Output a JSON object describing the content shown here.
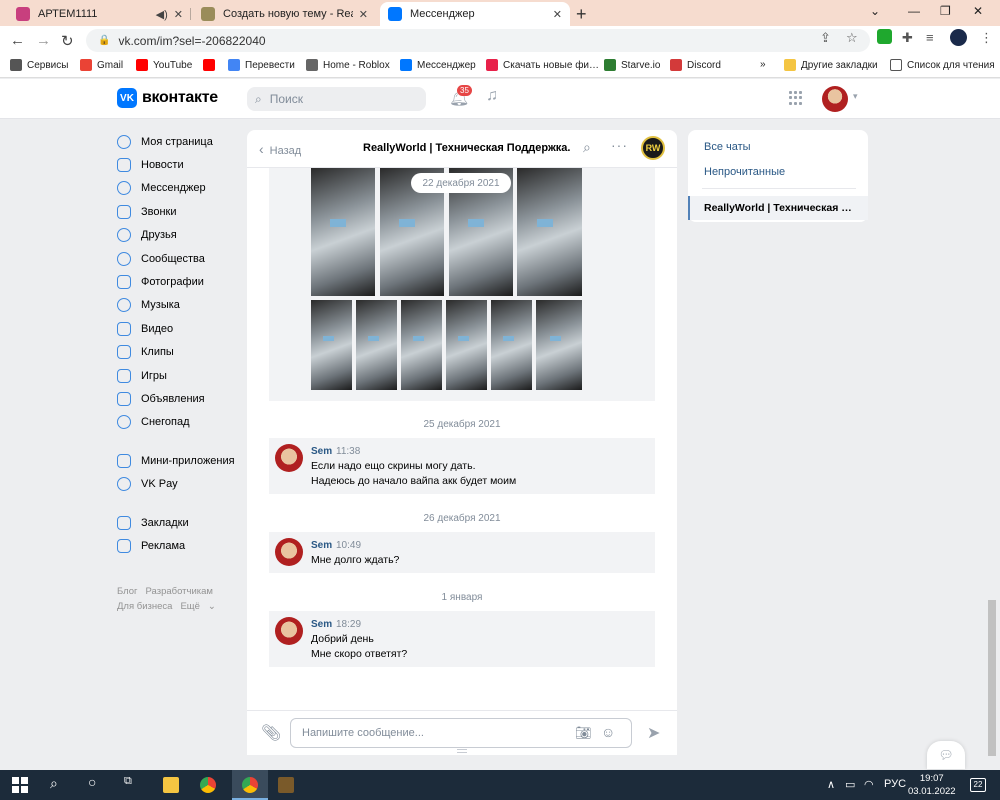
{
  "browser": {
    "tabs": [
      {
        "title": "АРТЕМ1111",
        "fav_color": "#c83f7e"
      },
      {
        "title": "Создать новую тему - ReallyWo…",
        "fav_color": "#9a8c5a"
      },
      {
        "title": "Мессенджер",
        "fav_color": "#0077ff",
        "active": true
      }
    ],
    "url": "vk.com/im?sel=-206822040",
    "bookmarks": [
      {
        "label": "Сервисы",
        "color": "#555555"
      },
      {
        "label": "Gmail",
        "color": "#ea4335"
      },
      {
        "label": "YouTube",
        "color": "#ff0000"
      },
      {
        "label": "",
        "color": "#ff0000"
      },
      {
        "label": "Перевести",
        "color": "#4285f4"
      },
      {
        "label": "Home - Roblox",
        "color": "#666666"
      },
      {
        "label": "Мессенджер",
        "color": "#0077ff"
      },
      {
        "label": "Скачать новые фи…",
        "color": "#e8214a"
      },
      {
        "label": "Starve.io",
        "color": "#2e7d32"
      },
      {
        "label": "Discord",
        "color": "#d33a3a"
      }
    ],
    "bookmarks_more": "»",
    "other_bookmarks": "Другие закладки",
    "reading_list": "Список для чтения"
  },
  "vk": {
    "logo_text": "вконтакте",
    "search_placeholder": "Поиск",
    "notifications_count": "35",
    "menu": [
      {
        "label": "Моя страница",
        "icon": "user-circle-icon"
      },
      {
        "label": "Новости",
        "icon": "news-icon"
      },
      {
        "label": "Мессенджер",
        "icon": "message-icon"
      },
      {
        "label": "Звонки",
        "icon": "phone-icon"
      },
      {
        "label": "Друзья",
        "icon": "friends-icon"
      },
      {
        "label": "Сообщества",
        "icon": "communities-icon"
      },
      {
        "label": "Фотографии",
        "icon": "photo-icon"
      },
      {
        "label": "Музыка",
        "icon": "music-icon"
      },
      {
        "label": "Видео",
        "icon": "video-icon"
      },
      {
        "label": "Клипы",
        "icon": "clips-icon"
      },
      {
        "label": "Игры",
        "icon": "games-icon"
      },
      {
        "label": "Объявления",
        "icon": "classifieds-icon"
      },
      {
        "label": "Снегопад",
        "icon": "snowflake-icon"
      }
    ],
    "menu2": [
      {
        "label": "Мини-приложения",
        "icon": "apps-icon"
      },
      {
        "label": "VK Pay",
        "icon": "vkpay-icon"
      }
    ],
    "menu3": [
      {
        "label": "Закладки",
        "icon": "star-icon"
      },
      {
        "label": "Реклама",
        "icon": "ads-icon"
      }
    ],
    "footer": {
      "blog": "Блог",
      "devs": "Разработчикам",
      "business": "Для бизнеса",
      "more": "Ещё"
    }
  },
  "chat": {
    "back_label": "Назад",
    "title": "ReallyWorld | Техническая Поддержка.",
    "avatar_text": "RW",
    "photo_date": "22 декабря 2021",
    "groups": [
      {
        "date": "25 декабря 2021",
        "author": "Sem",
        "time": "11:38",
        "lines": [
          "Если надо ещо скрины могу дать.",
          "Надеюсь до начало вайпа акк будет моим"
        ]
      },
      {
        "date": "26 декабря 2021",
        "author": "Sem",
        "time": "10:49",
        "lines": [
          "Мне долго ждать?"
        ]
      },
      {
        "date": "1 января",
        "author": "Sem",
        "time": "18:29",
        "lines": [
          "Добрий день",
          "Мне скоро ответят?"
        ]
      }
    ],
    "composer_placeholder": "Напишите сообщение..."
  },
  "right": {
    "all_chats": "Все чаты",
    "unread": "Непрочитанные",
    "active_chat": "ReallyWorld | Техническая …"
  },
  "taskbar": {
    "lang": "РУС",
    "time": "19:07",
    "date": "03.01.2022",
    "notifications": "22"
  }
}
